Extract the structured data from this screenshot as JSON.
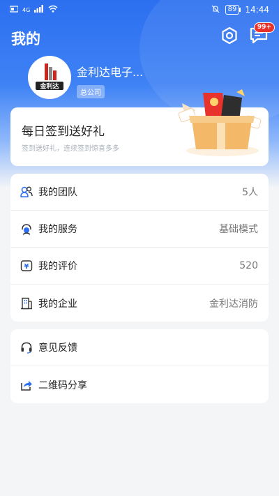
{
  "status_bar": {
    "time": "14:44",
    "battery": "89",
    "network": "4G"
  },
  "header": {
    "title": "我的",
    "message_badge": "99+"
  },
  "profile": {
    "company_name": "金利达电子...",
    "company_tag": "总公司",
    "logo_text": "金利达"
  },
  "signin": {
    "title": "每日签到送好礼",
    "subtitle": "签到送好礼，连续签到惊喜多多"
  },
  "menu1": [
    {
      "label": "我的团队",
      "value": "5人",
      "icon": "team-icon"
    },
    {
      "label": "我的服务",
      "value": "基础模式",
      "icon": "service-icon"
    },
    {
      "label": "我的评价",
      "value": "520",
      "icon": "rating-icon"
    },
    {
      "label": "我的企业",
      "value": "金利达消防",
      "icon": "enterprise-icon"
    }
  ],
  "menu2": [
    {
      "label": "意见反馈",
      "icon": "headset-icon"
    },
    {
      "label": "二维码分享",
      "icon": "share-icon"
    }
  ],
  "colors": {
    "primary": "#2c6ff0",
    "badge": "#e8332c"
  }
}
